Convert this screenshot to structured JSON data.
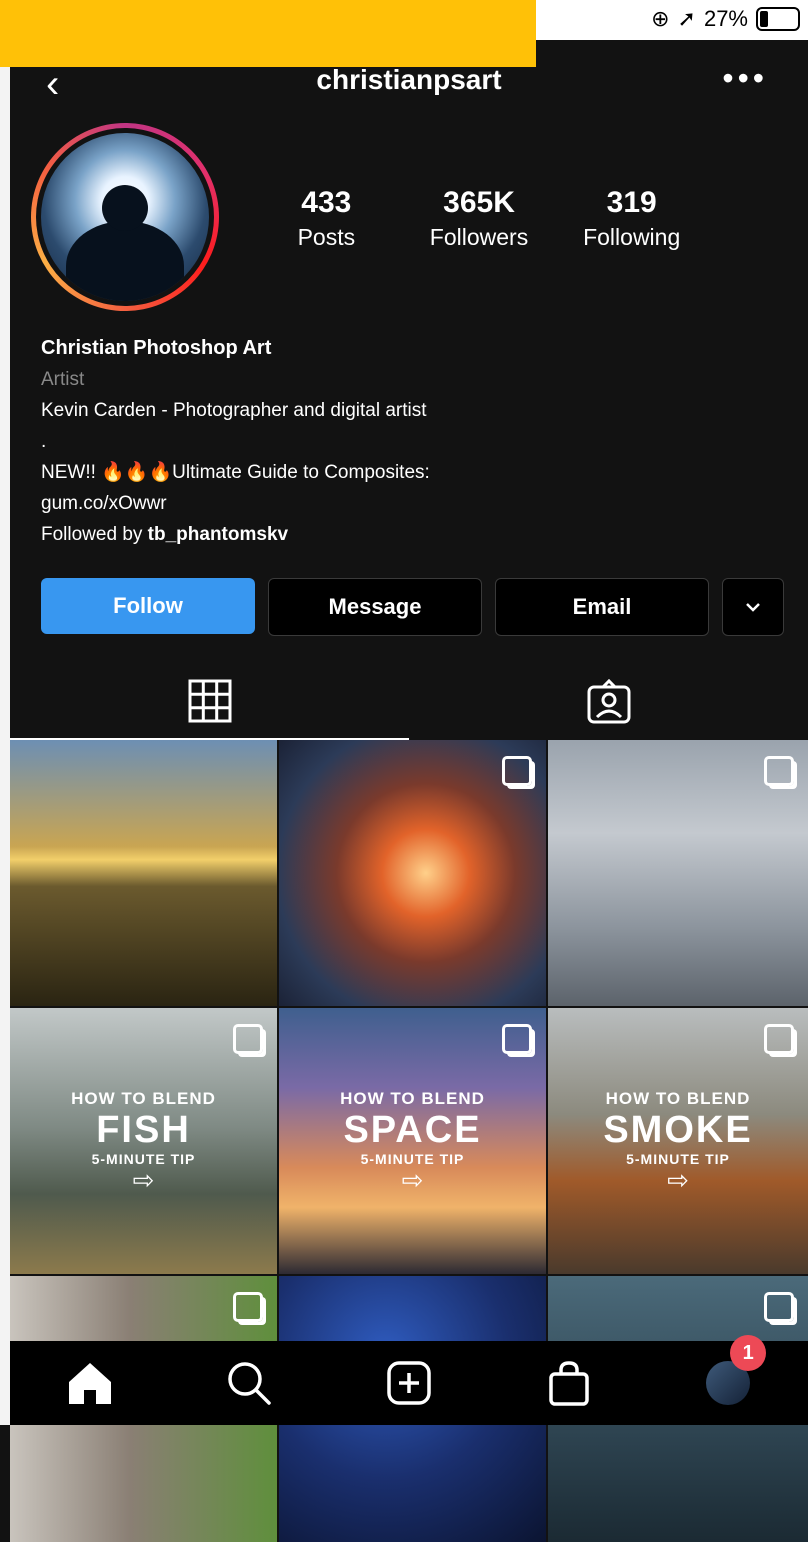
{
  "status": {
    "battery": "27%"
  },
  "header": {
    "username": "christianpsart"
  },
  "stats": [
    {
      "value": "433",
      "label": "Posts"
    },
    {
      "value": "365K",
      "label": "Followers"
    },
    {
      "value": "319",
      "label": "Following"
    }
  ],
  "bio": {
    "name": "Christian Photoshop Art",
    "category": "Artist",
    "line1": "Kevin Carden - Photographer and digital artist",
    "line2": ".",
    "line3": "NEW!! 🔥🔥🔥Ultimate Guide to Composites:",
    "line4": "gum.co/xOwwr",
    "followed_prefix": "Followed by ",
    "followed_user": "tb_phantomskv"
  },
  "buttons": {
    "follow": "Follow",
    "message": "Message",
    "email": "Email"
  },
  "posts": [
    {
      "overlay": null
    },
    {
      "overlay": null
    },
    {
      "overlay": null
    },
    {
      "overlay": {
        "line1": "HOW TO BLEND",
        "line2": "FISH",
        "line3": "5-MINUTE TIP"
      }
    },
    {
      "overlay": {
        "line1": "HOW TO BLEND",
        "line2": "SPACE",
        "line3": "5-MINUTE TIP"
      }
    },
    {
      "overlay": {
        "line1": "HOW TO BLEND",
        "line2": "SMOKE",
        "line3": "5-MINUTE TIP"
      }
    }
  ],
  "nav": {
    "notification_count": "1"
  }
}
